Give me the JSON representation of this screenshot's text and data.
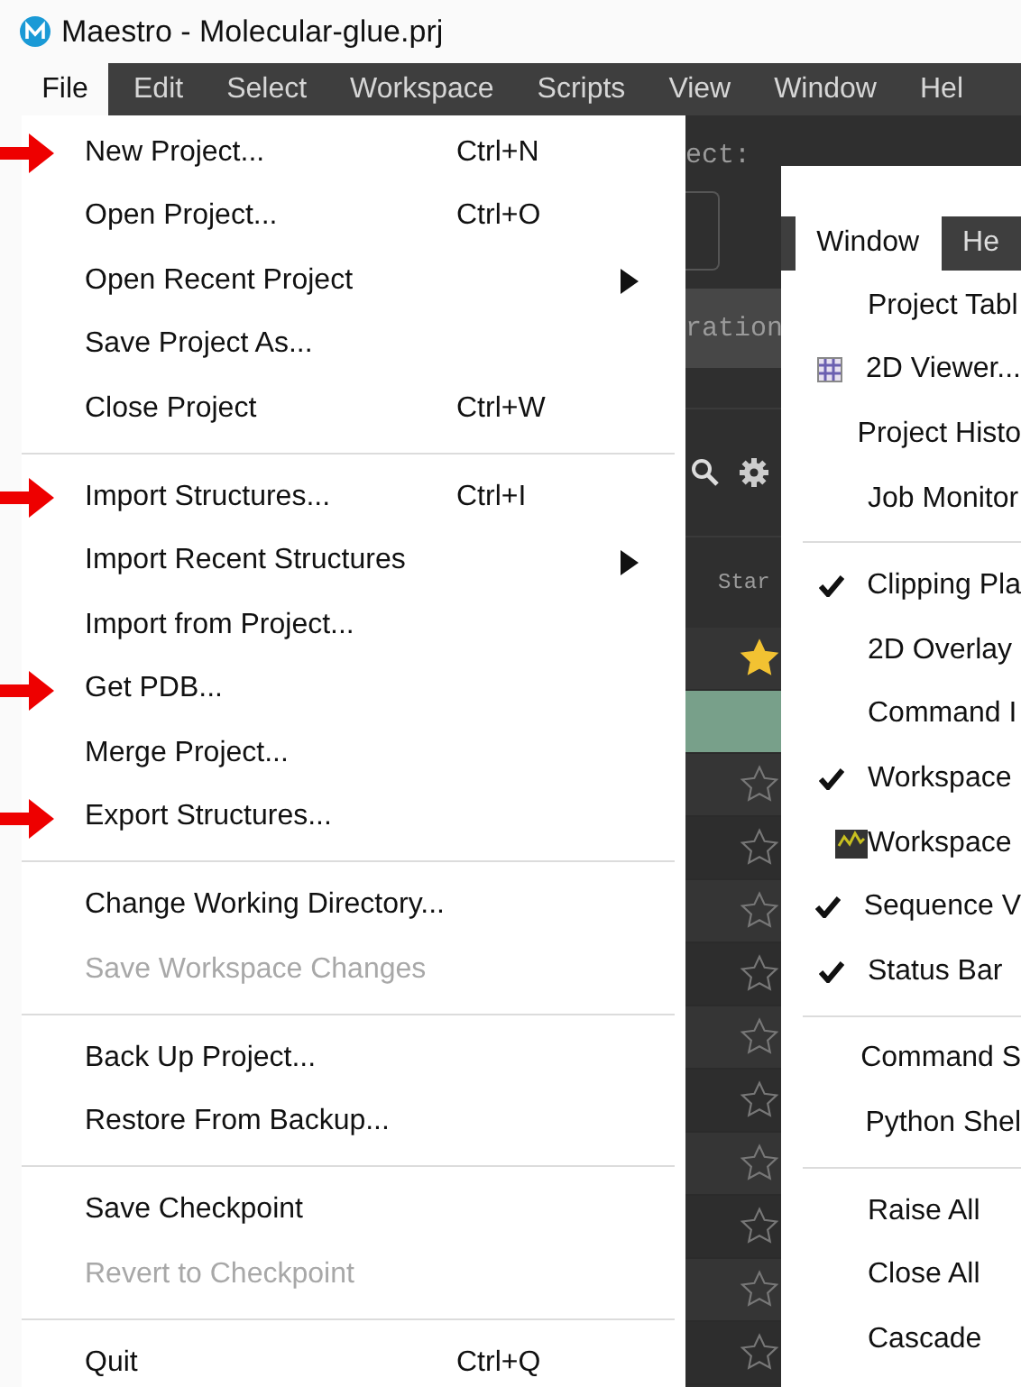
{
  "window": {
    "title": "Maestro - Molecular-glue.prj"
  },
  "menu_bar": [
    {
      "label": "File",
      "selected": true
    },
    {
      "label": "Edit",
      "selected": false
    },
    {
      "label": "Select",
      "selected": false
    },
    {
      "label": "Workspace",
      "selected": false
    },
    {
      "label": "Scripts",
      "selected": false
    },
    {
      "label": "View",
      "selected": false
    },
    {
      "label": "Window",
      "selected": false
    },
    {
      "label": "Hel",
      "selected": false
    }
  ],
  "background_panel": {
    "select_label": "ect:",
    "band_label": "ration",
    "column_header": "Star",
    "rows": [
      {
        "starred": true,
        "selected": false
      },
      {
        "selected": true
      },
      {
        "starred": false,
        "selected": false
      },
      {
        "starred": false,
        "selected": false
      },
      {
        "starred": false,
        "selected": false
      },
      {
        "starred": false,
        "selected": false
      },
      {
        "starred": false,
        "selected": false
      },
      {
        "starred": false,
        "selected": false
      },
      {
        "starred": false,
        "selected": false
      },
      {
        "starred": false,
        "selected": false
      },
      {
        "starred": false,
        "selected": false
      },
      {
        "starred": false,
        "selected": false
      }
    ]
  },
  "file_menu": {
    "groups": [
      [
        {
          "label": "New Project...",
          "shortcut": "Ctrl+N",
          "submenu": false,
          "disabled": false,
          "marked": true
        },
        {
          "label": "Open Project...",
          "shortcut": "Ctrl+O",
          "submenu": false,
          "disabled": false,
          "marked": false
        },
        {
          "label": "Open Recent Project",
          "submenu": true,
          "disabled": false,
          "marked": false
        },
        {
          "label": "Save Project As...",
          "submenu": false,
          "disabled": false,
          "marked": false
        },
        {
          "label": "Close Project",
          "shortcut": "Ctrl+W",
          "submenu": false,
          "disabled": false,
          "marked": false
        }
      ],
      [
        {
          "label": "Import Structures...",
          "shortcut": "Ctrl+I",
          "submenu": false,
          "disabled": false,
          "marked": true
        },
        {
          "label": "Import Recent Structures",
          "submenu": true,
          "disabled": false,
          "marked": false
        },
        {
          "label": "Import from Project...",
          "submenu": false,
          "disabled": false,
          "marked": false
        },
        {
          "label": "Get PDB...",
          "submenu": false,
          "disabled": false,
          "marked": true
        },
        {
          "label": "Merge Project...",
          "submenu": false,
          "disabled": false,
          "marked": false
        },
        {
          "label": "Export Structures...",
          "submenu": false,
          "disabled": false,
          "marked": true
        }
      ],
      [
        {
          "label": "Change Working Directory...",
          "submenu": false,
          "disabled": false,
          "marked": false
        },
        {
          "label": "Save Workspace Changes",
          "submenu": false,
          "disabled": true,
          "marked": false
        }
      ],
      [
        {
          "label": "Back Up Project...",
          "submenu": false,
          "disabled": false,
          "marked": false
        },
        {
          "label": "Restore From Backup...",
          "submenu": false,
          "disabled": false,
          "marked": false
        }
      ],
      [
        {
          "label": "Save Checkpoint",
          "submenu": false,
          "disabled": false,
          "marked": false
        },
        {
          "label": "Revert to Checkpoint",
          "submenu": false,
          "disabled": true,
          "marked": false
        }
      ],
      [
        {
          "label": "Quit",
          "shortcut": "Ctrl+Q",
          "submenu": false,
          "disabled": false,
          "marked": false
        }
      ]
    ]
  },
  "window_menu_inset": {
    "tabs": [
      {
        "label": "Window",
        "selected": true
      },
      {
        "label": "He",
        "selected": false
      }
    ],
    "groups": [
      [
        {
          "label": "Project Tabl",
          "kind": "plain",
          "checked": false
        },
        {
          "label": "2D Viewer...",
          "kind": "grid",
          "checked": false
        },
        {
          "label": "Project Histo",
          "kind": "plain",
          "checked": false
        },
        {
          "label": "Job Monitor",
          "kind": "plain",
          "checked": false
        }
      ],
      [
        {
          "label": "Clipping Pla",
          "kind": "plain",
          "checked": true
        },
        {
          "label": "2D Overlay",
          "kind": "plain",
          "checked": false
        },
        {
          "label": "Command I",
          "kind": "plain",
          "checked": false
        },
        {
          "label": "Workspace",
          "kind": "plain",
          "checked": true
        },
        {
          "label": "Workspace",
          "kind": "monitor",
          "checked": false
        },
        {
          "label": "Sequence V",
          "kind": "plain",
          "checked": true
        },
        {
          "label": "Status Bar",
          "kind": "plain",
          "checked": true
        }
      ],
      [
        {
          "label": "Command S",
          "kind": "plain",
          "checked": false
        },
        {
          "label": "Python Shel",
          "kind": "plain",
          "checked": false
        }
      ],
      [
        {
          "label": "Raise All",
          "kind": "plain",
          "checked": false
        },
        {
          "label": "Close All",
          "kind": "plain",
          "checked": false
        },
        {
          "label": "Cascade",
          "kind": "plain",
          "checked": false
        }
      ]
    ]
  }
}
